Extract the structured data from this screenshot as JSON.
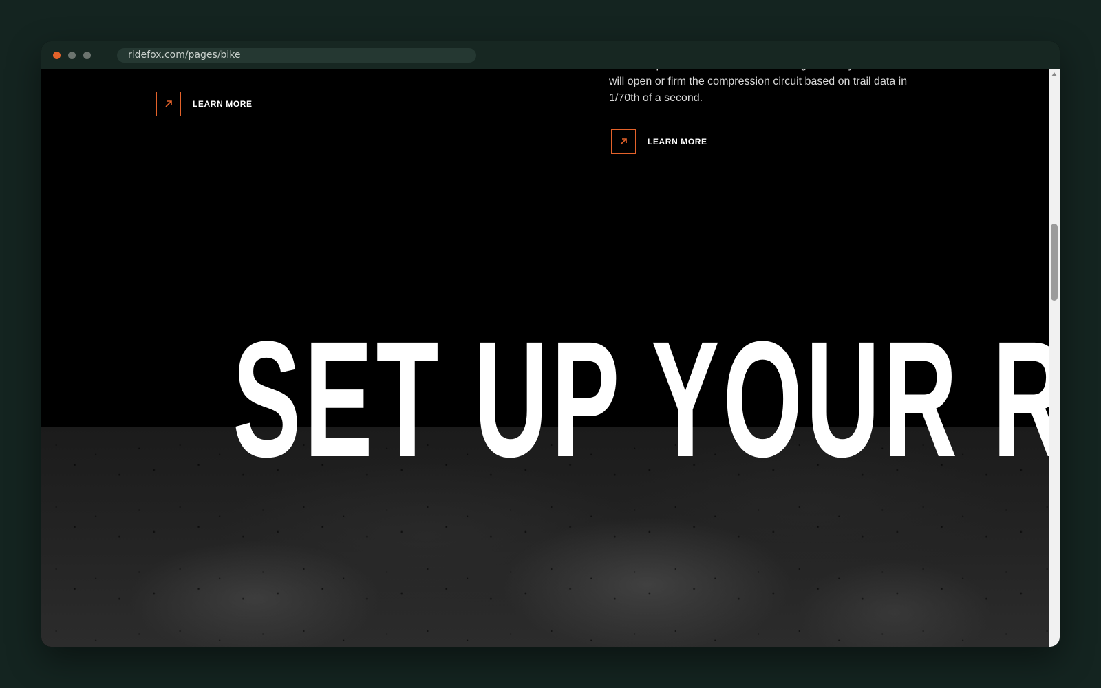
{
  "browser": {
    "url": "ridefox.com/pages/bike"
  },
  "content": {
    "left_link_label": "LEARN MORE",
    "right_description": "fade-free performance and class-leading durability, the Controller will open or firm the compression circuit based on trail data in 1/70th of a second.",
    "right_link_label": "LEARN MORE",
    "headline": "SET UP YOUR RIDE"
  },
  "colors": {
    "accent": "#e4622a",
    "page_background": "#000000",
    "desktop_background": "#142420",
    "text": "#ffffff"
  },
  "icons": {
    "link_icon": "arrow-up-right-icon",
    "scroll_icon": "chevron-up-icon"
  }
}
